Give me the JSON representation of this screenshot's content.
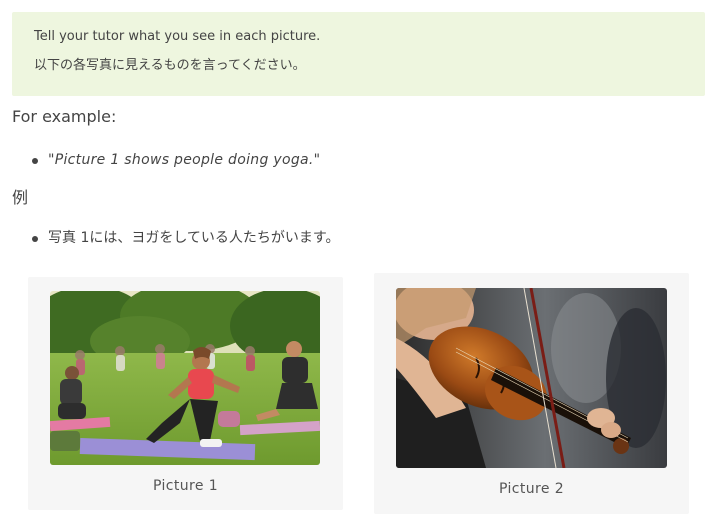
{
  "instructions": {
    "english": "Tell your tutor what you see in each picture.",
    "japanese": "以下の各写真に見えるものを言ってください。"
  },
  "example_heading": "For example:",
  "example_items": [
    "\"Picture 1 shows people doing yoga.\""
  ],
  "rei_heading": "例",
  "rei_items": [
    "写真 1には、ヨガをしている人たちがいます。"
  ],
  "pictures": [
    {
      "caption": "Picture 1",
      "icon": "yoga-photo"
    },
    {
      "caption": "Picture 2",
      "icon": "violin-photo"
    }
  ],
  "colors": {
    "notice_bg": "#eef6df",
    "card_bg": "#f6f6f6",
    "text": "#444444"
  }
}
